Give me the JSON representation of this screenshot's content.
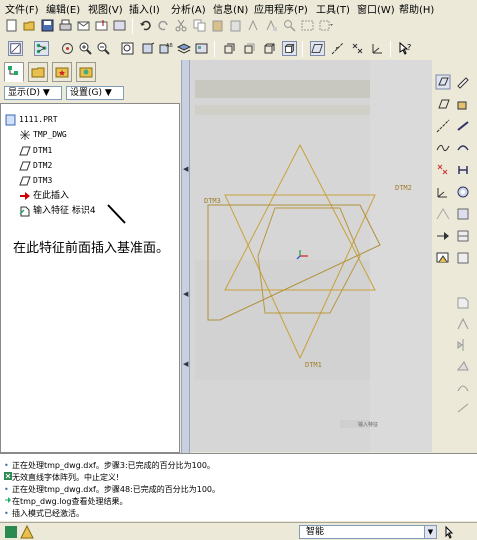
{
  "menu": [
    {
      "label": "文件(F)"
    },
    {
      "label": "编辑(E)"
    },
    {
      "label": "视图(V)"
    },
    {
      "label": "插入(I)"
    },
    {
      "label": "分析(A)"
    },
    {
      "label": "信息(N)"
    },
    {
      "label": "应用程序(P)"
    },
    {
      "label": "工具(T)"
    },
    {
      "label": "窗口(W)"
    },
    {
      "label": "帮助(H)"
    }
  ],
  "left_panel": {
    "show_label": "显示(D) ▼",
    "settings_label": "设置(G) ▼",
    "tree": [
      {
        "label": "1111.PRT",
        "icon": "part-icon"
      },
      {
        "label": "TMP_DWG",
        "icon": "coordinate-system-icon"
      },
      {
        "label": "DTM1",
        "icon": "datum-plane-icon"
      },
      {
        "label": "DTM2",
        "icon": "datum-plane-icon"
      },
      {
        "label": "DTM3",
        "icon": "datum-plane-icon"
      },
      {
        "label": "在此插入",
        "icon": "insert-arrow-icon"
      },
      {
        "label": "输入特征 标识4",
        "icon": "import-feature-icon"
      }
    ],
    "annotation": "在此特征前面插入基准面。"
  },
  "graphics": {
    "datum_labels": [
      "DTM3",
      "DTM2",
      "DTM1"
    ],
    "small_label": "输入特征"
  },
  "messages": [
    {
      "text": "正在处理tmp_dwg.dxf。步骤3:已完成的百分比为100。",
      "icon": "bullet-icon"
    },
    {
      "text": "无效直线字体阵列。中止定义!",
      "icon": "warning-icon"
    },
    {
      "text": "正在处理tmp_dwg.dxf。步骤48:已完成的百分比为100。",
      "icon": "bullet-icon"
    },
    {
      "text": "在tmp_dwg.log查看处理结果。",
      "icon": "info-arrow-icon"
    },
    {
      "text": "插入模式已经激活。",
      "icon": "bullet-icon"
    }
  ],
  "status": {
    "filter_value": "智能"
  }
}
